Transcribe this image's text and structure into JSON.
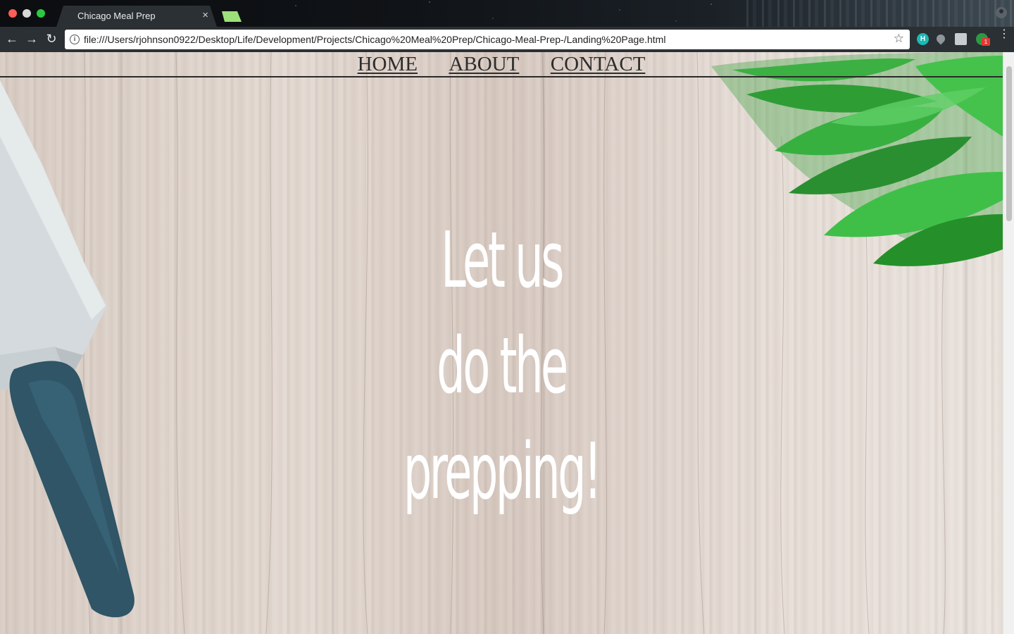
{
  "browser": {
    "tab_title": "Chicago Meal Prep",
    "tab_close": "×",
    "url": "file:///Users/rjohnson0922/Desktop/Life/Development/Projects/Chicago%20Meal%20Prep/Chicago-Meal-Prep-/Landing%20Page.html",
    "back_glyph": "←",
    "forward_glyph": "→",
    "reload_glyph": "↻",
    "star_glyph": "☆",
    "info_glyph": "i",
    "menu_glyph": "⋮",
    "extensions": [
      {
        "name": "h-extension-icon",
        "label": "H"
      },
      {
        "name": "pin-extension-icon",
        "label": ""
      },
      {
        "name": "wrench-extension-icon",
        "label": ""
      },
      {
        "name": "badge-extension-icon",
        "label": "1"
      }
    ]
  },
  "nav": {
    "home": "HOME",
    "about": "ABOUT",
    "contact": "CONTACT"
  },
  "hero": {
    "line1": "Let us",
    "line2": "do the",
    "line3": "prepping!"
  }
}
